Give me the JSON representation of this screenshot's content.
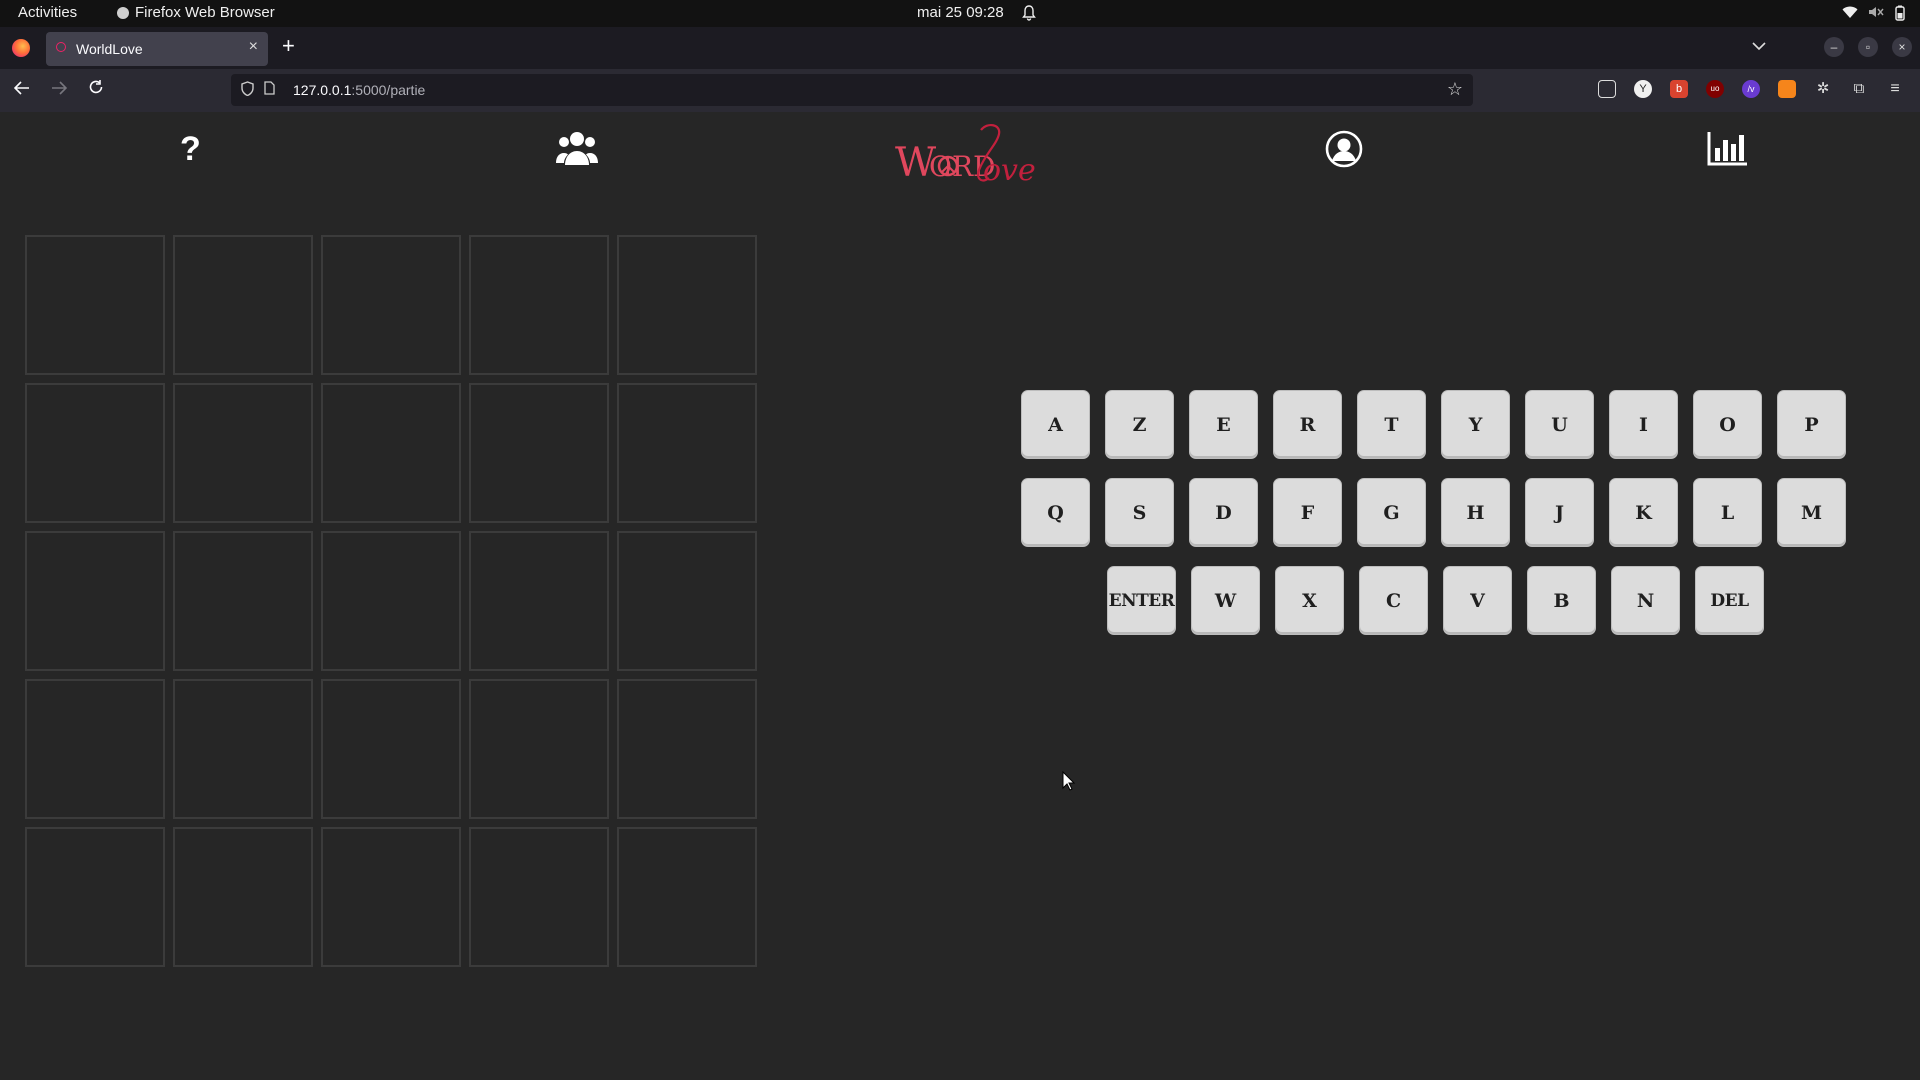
{
  "system_bar": {
    "activities": "Activities",
    "app_name": "Firefox Web Browser",
    "clock": "mai 25  09:28"
  },
  "browser": {
    "tab_title": "WorldLove",
    "url_host": "127.0.0.1",
    "url_path": ":5000/partie"
  },
  "app": {
    "logo_word": "WORD",
    "logo_script": "Love",
    "header_icons": [
      "help-icon",
      "users-icon",
      "account-icon",
      "stats-icon"
    ],
    "help_glyph": "?",
    "brand_color": "#e0475d"
  },
  "board": {
    "rows": 5,
    "cols": 5,
    "letters": [
      [
        "",
        "",
        "",
        "",
        ""
      ],
      [
        "",
        "",
        "",
        "",
        ""
      ],
      [
        "",
        "",
        "",
        "",
        ""
      ],
      [
        "",
        "",
        "",
        "",
        ""
      ],
      [
        "",
        "",
        "",
        "",
        ""
      ]
    ]
  },
  "keyboard": {
    "row1": [
      "A",
      "Z",
      "E",
      "R",
      "T",
      "Y",
      "U",
      "I",
      "O",
      "P"
    ],
    "row2": [
      "Q",
      "S",
      "D",
      "F",
      "G",
      "H",
      "J",
      "K",
      "L",
      "M"
    ],
    "row3": [
      "ENTER",
      "W",
      "X",
      "C",
      "V",
      "B",
      "N",
      "DEL"
    ]
  }
}
